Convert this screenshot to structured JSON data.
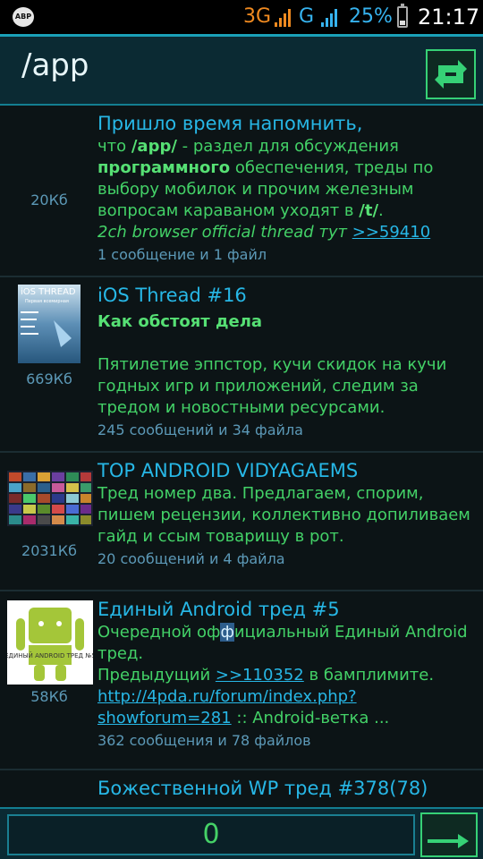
{
  "status_bar": {
    "adblock": "ABP",
    "network1": "3G",
    "network2": "G",
    "battery": "25%",
    "time": "21:17"
  },
  "header": {
    "title": "/app"
  },
  "threads": [
    {
      "size": "20Кб",
      "subject": "Пришло время напомнить,",
      "comment_parts": [
        "что ",
        "/app/",
        " - раздел для обсуждения ",
        "программного",
        " обеспечения, треды по выбору мобилок и прочим железным вопросам караваном уходят в ",
        "/t/",
        ".",
        "2ch browser official thread тут ",
        ">>59410"
      ],
      "counts": "1 сообщение и 1 файл"
    },
    {
      "size": "669Кб",
      "subject": "iOS Thread #16",
      "comment_heading": "Как обстоят дела",
      "comment": "Пятилетие эппстор, кучи скидок на кучи годных игр и приложений, следим за тредом и новостными ресурсами.",
      "counts": "245 сообщений и 34 файла",
      "thumb_title": "iOS THREAD",
      "thumb_subtitle": "Первая всемирная"
    },
    {
      "size": "2031Кб",
      "subject": "TOP ANDROID VIDYAGAEMS",
      "comment": "Тред номер два. Предлагаем, спорим, пишем рецензии, коллективно допиливаем гайд и ссым товарищу в рот.",
      "counts": "20 сообщений и 4 файла"
    },
    {
      "size": "58Кб",
      "subject": "Единый Android тред #5",
      "comment_a": "Очередной оф",
      "comment_sel": "ф",
      "comment_b": "ициальный Единый Android тред.",
      "prev_label": "Предыдущий ",
      "prev_link": ">>110352",
      "prev_tail": " в бамплимите.",
      "url": "http://4pda.ru/forum/index.php?showforum=281",
      "url_tail": " :: Android-ветка ...",
      "counts": "362 сообщения и 78 файлов",
      "thumb_text": "ЕДИНЫЙ ANDROID ТРЕД №5"
    },
    {
      "subject": "Божественной WP тред #378(78)"
    }
  ],
  "bottom_bar": {
    "page_value": "0"
  },
  "colors": {
    "accent_blue": "#27b7e6",
    "accent_green": "#43d167",
    "meta": "#5c99b7",
    "background": "#0c1416"
  },
  "icons": {
    "refresh": "refresh-icon",
    "go": "arrow-right-icon"
  }
}
